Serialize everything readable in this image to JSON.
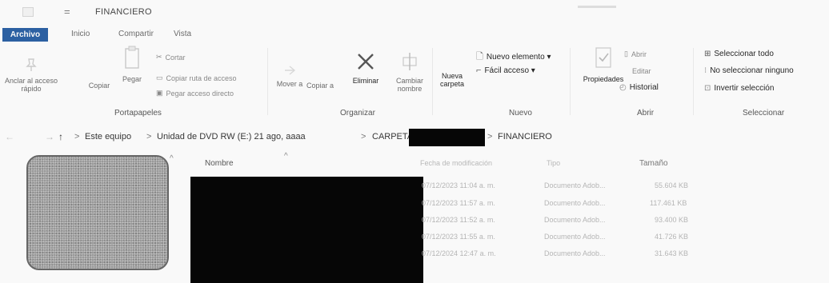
{
  "window": {
    "title": "FINANCIERO",
    "qa_sep": "="
  },
  "tabs": [
    {
      "label": "Archivo"
    },
    {
      "label": "Inicio"
    },
    {
      "label": "Compartir"
    },
    {
      "label": "Vista"
    }
  ],
  "ribbon": {
    "portapapeles": {
      "label": "Portapapeles",
      "anclar": "Anclar al acceso rápido",
      "copiar": "Copiar",
      "pegar": "Pegar",
      "cortar": "Cortar",
      "copiar_ruta": "Copiar ruta de acceso",
      "pegar_acceso": "Pegar acceso directo"
    },
    "organizar": {
      "label": "Organizar",
      "mover": "Mover a",
      "copiar_a": "Copiar a",
      "eliminar": "Eliminar",
      "cambiar_nombre": "Cambiar nombre"
    },
    "nuevo": {
      "label": "Nuevo",
      "nueva_carpeta": "Nueva carpeta",
      "nuevo_elemento": "Nuevo elemento ▾",
      "facil_acceso": "Fácil acceso ▾"
    },
    "abrir": {
      "label": "Abrir",
      "propiedades": "Propiedades",
      "abrir": "Abrir",
      "editar": "Editar",
      "historial": "Historial"
    },
    "seleccionar": {
      "label": "Seleccionar",
      "todo": "Seleccionar todo",
      "ninguno": "No seleccionar ninguno",
      "invertir": "Invertir selección"
    }
  },
  "address": {
    "back": "←",
    "forward": "→",
    "up": "↑",
    "crumbs": [
      "Este equipo",
      "Unidad de DVD RW (E:) 21 ago, aaaa",
      "CARPETA",
      "FINANCIERO"
    ],
    "sep": ">"
  },
  "columns": {
    "nombre": "Nombre",
    "fecha": "Fecha de modificación",
    "tipo": "Tipo",
    "tamano": "Tamaño"
  },
  "files": [
    {
      "fecha": "07/12/2023 11:04 a. m.",
      "tipo": "Documento Adob...",
      "tamano": "55.604 KB"
    },
    {
      "fecha": "07/12/2023 11:57 a. m.",
      "tipo": "Documento Adob...",
      "tamano": "117.461 KB"
    },
    {
      "fecha": "07/12/2023 11:52 a. m.",
      "tipo": "Documento Adob...",
      "tamano": "93.400 KB"
    },
    {
      "fecha": "07/12/2023 11:55 a. m.",
      "tipo": "Documento Adob...",
      "tamano": "41.726 KB"
    },
    {
      "fecha": "07/12/2024 12:47 a. m.",
      "tipo": "Documento Adob...",
      "tamano": "31.643 KB"
    }
  ]
}
